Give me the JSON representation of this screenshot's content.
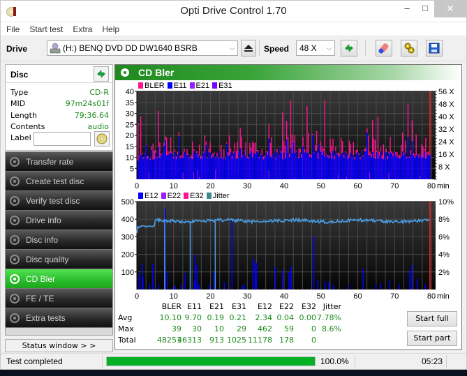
{
  "window": {
    "title": "Opti Drive Control 1.70",
    "min": "–",
    "max": "□",
    "close": "✕"
  },
  "menu": [
    "File",
    "Start test",
    "Extra",
    "Help"
  ],
  "toolbar": {
    "drive_label": "Drive",
    "drive_value": "(H:)  BENQ DVD DD DW1640 BSRB",
    "speed_label": "Speed",
    "speed_value": "48 X"
  },
  "disc": {
    "title": "Disc",
    "fields": [
      {
        "key": "Type",
        "value": "CD-R"
      },
      {
        "key": "MID",
        "value": "97m24s01f"
      },
      {
        "key": "Length",
        "value": "79:36.64"
      },
      {
        "key": "Contents",
        "value": "audio"
      }
    ],
    "label_key": "Label",
    "label_value": ""
  },
  "nav": {
    "items": [
      {
        "label": "Transfer rate",
        "active": false
      },
      {
        "label": "Create test disc",
        "active": false
      },
      {
        "label": "Verify test disc",
        "active": false
      },
      {
        "label": "Drive info",
        "active": false
      },
      {
        "label": "Disc info",
        "active": false
      },
      {
        "label": "Disc quality",
        "active": false
      },
      {
        "label": "CD Bler",
        "active": true
      },
      {
        "label": "FE / TE",
        "active": false
      },
      {
        "label": "Extra tests",
        "active": false
      }
    ],
    "status_window": "Status window > >"
  },
  "panel": {
    "title": "CD Bler"
  },
  "chart_data": [
    {
      "type": "bar",
      "title": "BLER / E11 / E21 / E31",
      "legend": [
        {
          "name": "BLER",
          "color": "#ff1493"
        },
        {
          "name": "E11",
          "color": "#0000ff"
        },
        {
          "name": "E21",
          "color": "#9b1cff"
        },
        {
          "name": "E31",
          "color": "#7a00ff"
        }
      ],
      "xlabel": "min",
      "xlim": [
        0,
        80
      ],
      "xticks": [
        0,
        10,
        20,
        30,
        40,
        50,
        60,
        70,
        80
      ],
      "ylim": [
        0,
        40
      ],
      "yticks": [
        5,
        10,
        15,
        20,
        25,
        30,
        35,
        40
      ],
      "y2ticks": [
        "8 X",
        "16 X",
        "24 X",
        "32 X",
        "40 X",
        "48 X",
        "56 X"
      ],
      "y2lim": [
        0,
        56
      ],
      "summary": {
        "BLER_avg": 10.1,
        "E11_avg": 9.7,
        "BLER_max": 39,
        "E11_max": 30
      },
      "grid": true
    },
    {
      "type": "bar",
      "title": "E12 / E22 / E32 / Jitter",
      "legend": [
        {
          "name": "E12",
          "color": "#0000ff"
        },
        {
          "name": "E22",
          "color": "#9b1cff"
        },
        {
          "name": "E32",
          "color": "#ff1493"
        },
        {
          "name": "Jitter",
          "color": "#3a8c8c"
        }
      ],
      "xlabel": "min",
      "xlim": [
        0,
        80
      ],
      "xticks": [
        0,
        10,
        20,
        30,
        40,
        50,
        60,
        70,
        80
      ],
      "ylim": [
        0,
        500
      ],
      "yticks": [
        100,
        200,
        300,
        400,
        500
      ],
      "y2ticks": [
        "2%",
        "4%",
        "6%",
        "8%",
        "10%"
      ],
      "y2lim": [
        0,
        10
      ],
      "e12_spikes": [
        {
          "x": 0.5,
          "y": 90
        },
        {
          "x": 1.3,
          "y": 145
        },
        {
          "x": 1.5,
          "y": 70
        },
        {
          "x": 3.3,
          "y": 28
        },
        {
          "x": 4.1,
          "y": 45
        },
        {
          "x": 4.2,
          "y": 148
        },
        {
          "x": 5.7,
          "y": 30
        },
        {
          "x": 7.6,
          "y": 462
        },
        {
          "x": 8.2,
          "y": 100
        },
        {
          "x": 9.5,
          "y": 10
        },
        {
          "x": 10.3,
          "y": 22
        },
        {
          "x": 11.9,
          "y": 28
        },
        {
          "x": 13.0,
          "y": 96
        },
        {
          "x": 15.5,
          "y": 48
        },
        {
          "x": 15.7,
          "y": 200
        },
        {
          "x": 16.2,
          "y": 140
        },
        {
          "x": 16.7,
          "y": 28
        },
        {
          "x": 19.6,
          "y": 28
        },
        {
          "x": 20.8,
          "y": 100
        },
        {
          "x": 23.6,
          "y": 42
        },
        {
          "x": 25.7,
          "y": 395
        },
        {
          "x": 28.5,
          "y": 20
        },
        {
          "x": 29.0,
          "y": 35
        },
        {
          "x": 31.4,
          "y": 180
        },
        {
          "x": 32.0,
          "y": 155
        },
        {
          "x": 32.3,
          "y": 150
        },
        {
          "x": 37.5,
          "y": 130
        },
        {
          "x": 39.4,
          "y": 110
        },
        {
          "x": 41.2,
          "y": 100
        },
        {
          "x": 41.8,
          "y": 130
        },
        {
          "x": 47.9,
          "y": 305
        },
        {
          "x": 49.0,
          "y": 52
        },
        {
          "x": 51.0,
          "y": 45
        },
        {
          "x": 52.0,
          "y": 45
        },
        {
          "x": 53.3,
          "y": 28
        },
        {
          "x": 57.3,
          "y": 30
        },
        {
          "x": 61.3,
          "y": 120
        },
        {
          "x": 64.8,
          "y": 30
        },
        {
          "x": 66.0,
          "y": 38
        },
        {
          "x": 68.5,
          "y": 50
        },
        {
          "x": 71.0,
          "y": 32
        },
        {
          "x": 74.0,
          "y": 108
        },
        {
          "x": 74.6,
          "y": 138
        },
        {
          "x": 76.0,
          "y": 60
        },
        {
          "x": 78.2,
          "y": 30
        }
      ],
      "jitter_percent_approx": {
        "start": 6.4,
        "plateau_0_5": 7.2,
        "steady": 7.8,
        "max": 8.6
      },
      "grid": true
    }
  ],
  "stats": {
    "headers": [
      "",
      "BLER",
      "E11",
      "E21",
      "E31",
      "E12",
      "E22",
      "E32",
      "Jitter"
    ],
    "rows": [
      {
        "label": "Avg",
        "values": [
          "10.10",
          "9.70",
          "0.19",
          "0.21",
          "2.34",
          "0.04",
          "0.00",
          "7.78%"
        ]
      },
      {
        "label": "Max",
        "values": [
          "39",
          "30",
          "10",
          "29",
          "462",
          "59",
          "0",
          "8.6%"
        ]
      },
      {
        "label": "Total",
        "values": [
          "48251",
          "46313",
          "913",
          "1025",
          "11178",
          "178",
          "0",
          ""
        ]
      }
    ],
    "start_full": "Start full",
    "start_part": "Start part"
  },
  "statusbar": {
    "message": "Test completed",
    "progress_percent": 100,
    "progress_text": "100.0%",
    "time": "05:23"
  }
}
